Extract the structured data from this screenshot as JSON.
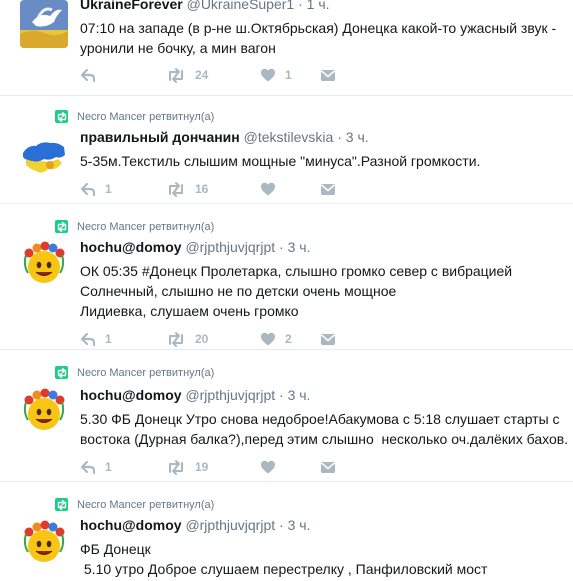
{
  "colors": {
    "icon": "#aab8c2",
    "retweet_badge": "#19cf86",
    "secondary_text": "#657786",
    "divider": "#e6ecf0"
  },
  "tweets": [
    {
      "retweet_context": "",
      "avatar_icon": "dove-on-flag-avatar",
      "name": "UkraineForever",
      "handle": "@UkraineSuper1",
      "dot": "·",
      "time": "1 ч.",
      "lines": [
        "07:10 на западе (в р-не ш.Октябрьская) Донецка какой-то ужасный звук -",
        "уронили не бочку, а мин вагон"
      ],
      "reply_count": "",
      "retweet_count": "24",
      "like_count": "1"
    },
    {
      "retweet_context": "Necro Mancer ретвитнул(а)",
      "avatar_icon": "ukraine-map-avatar",
      "name": "правильный дончанин",
      "handle": "@tekstilevskia",
      "dot": "·",
      "time": "3 ч.",
      "lines": [
        "5-35м.Текстиль слышим мощные \"минуса\".Разной громкости."
      ],
      "reply_count": "1",
      "retweet_count": "16",
      "like_count": ""
    },
    {
      "retweet_context": "Necro Mancer ретвитнул(а)",
      "avatar_icon": "emoji-wreath-avatar",
      "name": "hochu@domoy",
      "handle": "@rjpthjuvjqrjpt",
      "dot": "·",
      "time": "3 ч.",
      "lines": [
        "ОК 05:35 #Донецк Пролетарка, слышно громко север с вибрацией",
        "Солнечный, слышно не по детски очень мощное",
        "Лидиевка, слушаем очень громко"
      ],
      "reply_count": "1",
      "retweet_count": "20",
      "like_count": "2"
    },
    {
      "retweet_context": "Necro Mancer ретвитнул(а)",
      "avatar_icon": "emoji-wreath-avatar",
      "name": "hochu@domoy",
      "handle": "@rjpthjuvjqrjpt",
      "dot": "·",
      "time": "3 ч.",
      "lines": [
        "5.30 ФБ Донецк Утро снова недоброе!Абакумова с 5:18 слушает старты с",
        "востока (Дурная балка?),перед этим слышно  несколько оч.далёких бахов."
      ],
      "reply_count": "1",
      "retweet_count": "19",
      "like_count": ""
    },
    {
      "retweet_context": "Necro Mancer ретвитнул(а)",
      "avatar_icon": "emoji-wreath-avatar",
      "name": "hochu@domoy",
      "handle": "@rjpthjuvjqrjpt",
      "dot": "·",
      "time": "3 ч.",
      "lines": [
        "ФБ Донецк",
        " 5.10 утро Доброе слушаем перестрелку , Панфиловский мост"
      ],
      "reply_count": "",
      "retweet_count": "",
      "like_count": ""
    }
  ]
}
